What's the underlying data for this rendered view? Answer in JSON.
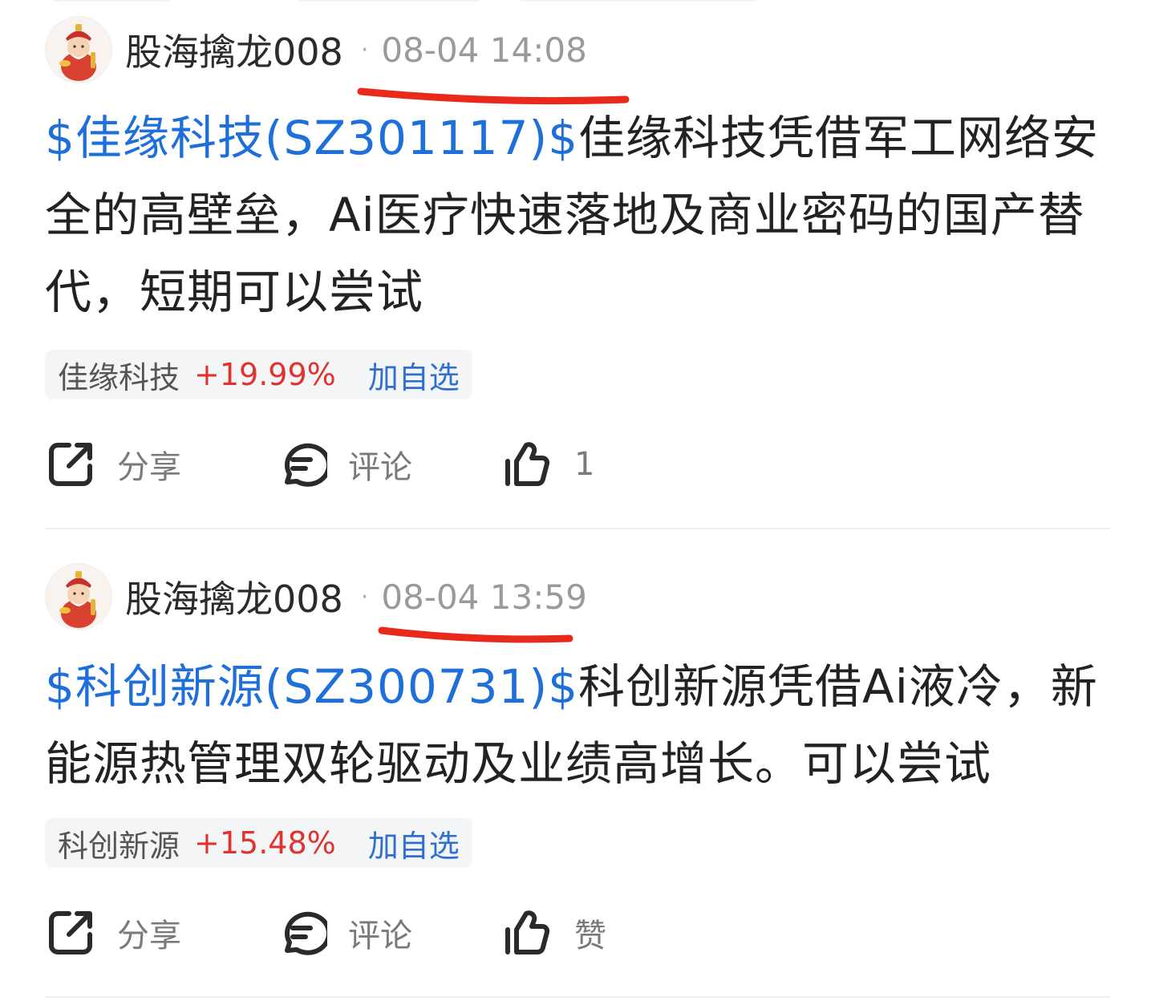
{
  "accent_color": "#1e6fd9",
  "rise_color": "#e0332f",
  "annotation_color": "#e8291c",
  "posts": [
    {
      "author": "股海擒龙008",
      "separator": "·",
      "time": "08-04 14:08",
      "ticker_label": "$佳缘科技(SZ301117)$",
      "lines": [
        "佳缘科技凭借军工网络安",
        "全的高壁垒，Ai医疗快速落地及商业密码的国产替",
        "代，短期可以尝试"
      ],
      "stock": {
        "name": "佳缘科技",
        "change": "+19.99%",
        "add_label": "加自选"
      },
      "actions": {
        "share_label": "分享",
        "comment_label": "评论",
        "like_label": "1",
        "share_icon": "share-icon",
        "comment_icon": "comment-icon",
        "like_icon": "thumbs-up-icon"
      }
    },
    {
      "author": "股海擒龙008",
      "separator": "·",
      "time": "08-04 13:59",
      "ticker_label": "$科创新源(SZ300731)$",
      "lines": [
        "科创新源凭借Ai液冷，新",
        "能源热管理双轮驱动及业绩高增长。可以尝试"
      ],
      "stock": {
        "name": "科创新源",
        "change": "+15.48%",
        "add_label": "加自选"
      },
      "actions": {
        "share_label": "分享",
        "comment_label": "评论",
        "like_label": "赞",
        "share_icon": "share-icon",
        "comment_icon": "comment-icon",
        "like_icon": "thumbs-up-icon"
      }
    }
  ]
}
